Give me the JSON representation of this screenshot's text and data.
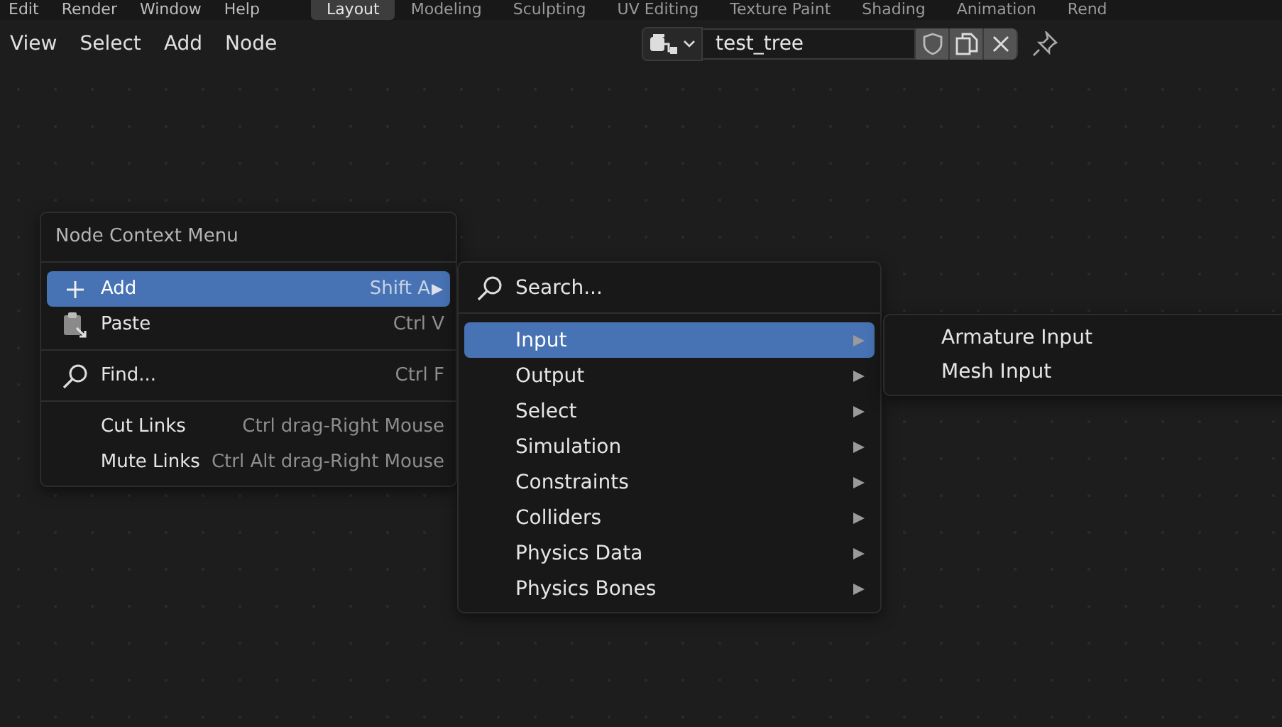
{
  "topbar": {
    "menus": [
      "Edit",
      "Render",
      "Window",
      "Help"
    ],
    "workspaces": [
      {
        "label": "Layout",
        "selected": true
      },
      {
        "label": "Modeling",
        "selected": false
      },
      {
        "label": "Sculpting",
        "selected": false
      },
      {
        "label": "UV Editing",
        "selected": false
      },
      {
        "label": "Texture Paint",
        "selected": false
      },
      {
        "label": "Shading",
        "selected": false
      },
      {
        "label": "Animation",
        "selected": false
      },
      {
        "label": "Rend",
        "selected": false
      }
    ]
  },
  "header": {
    "menus": [
      "View",
      "Select",
      "Add",
      "Node"
    ],
    "tree_name": "test_tree"
  },
  "context_menu": {
    "title": "Node Context Menu",
    "items": [
      {
        "kind": "plus",
        "label": "Add",
        "shortcut": "Shift A",
        "submenu": true,
        "selected": true
      },
      {
        "kind": "clipboard",
        "label": "Paste",
        "shortcut": "Ctrl V",
        "submenu": false,
        "selected": false
      },
      {
        "kind": "separator"
      },
      {
        "kind": "search",
        "label": "Find...",
        "shortcut": "Ctrl F",
        "submenu": false,
        "selected": false
      },
      {
        "kind": "separator"
      },
      {
        "kind": "plain",
        "label": "Cut Links",
        "shortcut": "Ctrl drag-Right Mouse",
        "submenu": false,
        "selected": false
      },
      {
        "kind": "plain",
        "label": "Mute Links",
        "shortcut": "Ctrl Alt drag-Right Mouse",
        "submenu": false,
        "selected": false
      }
    ]
  },
  "add_menu": {
    "search": "Search...",
    "items": [
      {
        "label": "Input",
        "selected": true
      },
      {
        "label": "Output",
        "selected": false
      },
      {
        "label": "Select",
        "selected": false
      },
      {
        "label": "Simulation",
        "selected": false
      },
      {
        "label": "Constraints",
        "selected": false
      },
      {
        "label": "Colliders",
        "selected": false
      },
      {
        "label": "Physics Data",
        "selected": false
      },
      {
        "label": "Physics Bones",
        "selected": false
      }
    ]
  },
  "input_menu": {
    "items": [
      {
        "label": "Armature Input",
        "selected": false
      },
      {
        "label": "Mesh Input",
        "selected": false
      }
    ]
  }
}
